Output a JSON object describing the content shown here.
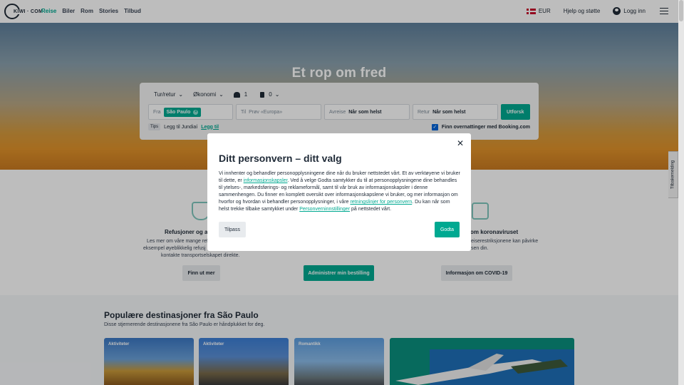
{
  "header": {
    "logo_text": "KIWI · COM",
    "nav": [
      "Reise",
      "Biler",
      "Rom",
      "Stories",
      "Tilbud"
    ],
    "currency": "EUR",
    "help": "Hjelp og støtte",
    "login": "Logg inn"
  },
  "hero": {
    "title": "Et rop om fred"
  },
  "search": {
    "trip_type": "Tur/retur",
    "cabin": "Økonomi",
    "passengers": "1",
    "bags": "0",
    "from_label": "Fra",
    "from_value": "São Paulo",
    "to_label": "Til",
    "to_placeholder": "Prøv «Europa»",
    "depart_label": "Avreise",
    "depart_value": "Når som helst",
    "return_label": "Retur",
    "return_value": "Når som helst",
    "explore_button": "Utforsk",
    "tips_label": "Tips",
    "tips_text": "Legg til Jundiaí",
    "tips_link": "Legg til",
    "booking_label": "Finn overnattinger med Booking.com"
  },
  "info": {
    "left_title": "Refusjoner og av",
    "left_text_1": "Les mer om våre mange ref",
    "left_text_2": "eksempel øyeblikkelig refusj",
    "left_text_3": "kontakte transportselskapet direkte.",
    "left_button": "Finn ut mer",
    "center_button": "Administrer min bestilling",
    "right_title": "om koronaviruset",
    "right_text_1": "eiserestriksjonene kan påvirke",
    "right_text_2": "sen din.",
    "right_button": "Informasjon om COVID-19"
  },
  "popular": {
    "title": "Populære destinasjoner fra São Paulo",
    "subtitle": "Disse stjernerende destinasjonene fra São Paulo er håndplukket for deg.",
    "cards": [
      {
        "tag": "Aktiviteter"
      },
      {
        "tag": "Aktiviteter"
      },
      {
        "tag": "Romantikk"
      }
    ]
  },
  "feedback": {
    "label": "Tilbakemelding"
  },
  "modal": {
    "title": "Ditt personvern – ditt valg",
    "p1": "Vi innhenter og behandler personopplysningene dine når du bruker nettstedet vårt. Et av verktøyene vi bruker til dette, er ",
    "link1": "informasjonskapsler",
    "p2": ". Ved å velge Godta samtykker du til at personopplysningene dine behandles til ytelses-, markedsførings- og reklameformål, samt til vår bruk av informasjonskapsler i denne sammenhengen. Du finner en komplett oversikt over informasjonskapslene vi bruker, og mer informasjon om hvorfor og hvordan vi behandler personopplysninger, i våre ",
    "link2": "retningslinjer for personvern",
    "p3": ". Du kan når som helst trekke tilbake samtykket under ",
    "link3": "Personverninnstillinger",
    "p4": " på nettstedet vårt.",
    "customize": "Tilpass",
    "accept": "Godta"
  },
  "colors": {
    "brand": "#00a991",
    "text": "#1f2a37"
  }
}
